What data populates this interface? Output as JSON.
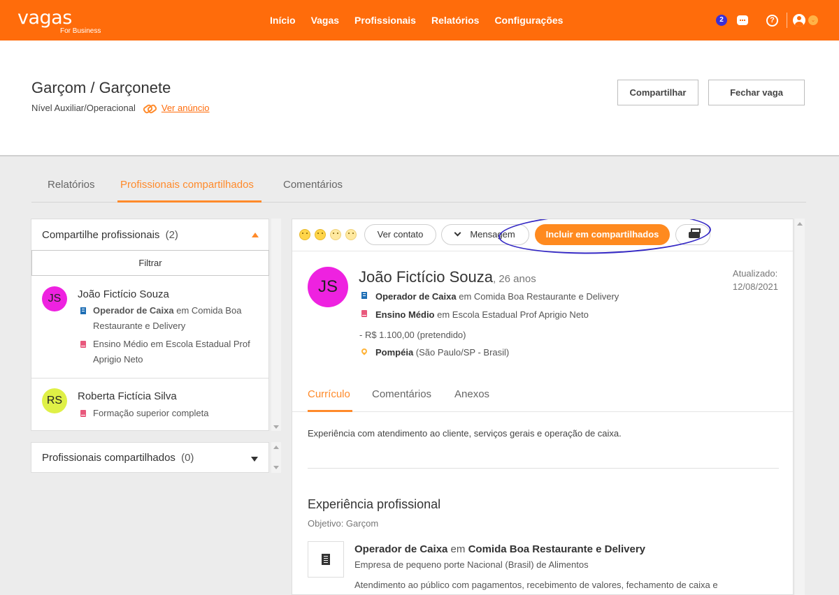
{
  "nav": {
    "logo_main": "vagas",
    "logo_sub": "For Business",
    "links": [
      "Início",
      "Vagas",
      "Profissionais",
      "Relatórios",
      "Configurações"
    ],
    "badge_count": "2",
    "help_glyph": "?",
    "chevron_glyph": "⌄"
  },
  "job": {
    "title": "Garçom / Garçonete",
    "level": "Nível Auxiliar/Operacional",
    "link": "Ver anúncio",
    "share_button": "Compartilhar",
    "close_button": "Fechar vaga"
  },
  "tabs": [
    "Relatórios",
    "Profissionais compartilhados",
    "Comentários"
  ],
  "left_panel": {
    "header": "Compartilhe profissionais",
    "count": "(2)",
    "filter_button": "Filtrar",
    "candidates": [
      {
        "initials": "JS",
        "avatar_color": "#ee22e0",
        "name": "João Fictício Souza",
        "job_bold": "Operador de Caixa",
        "job_rest": " em Comida Boa Restaurante e Delivery",
        "education": "Ensino Médio em Escola Estadual Prof Aprigio Neto"
      },
      {
        "initials": "RS",
        "avatar_color": "#dff046",
        "name": "Roberta Fictícia Silva",
        "education": "Formação superior completa"
      }
    ],
    "shared_header": "Profissionais compartilhados",
    "shared_count": "(0)"
  },
  "toolbar": {
    "contact_button": "Ver contato",
    "message_button": "Mensagem",
    "include_button": "Incluir em compartilhados",
    "accent_color": "#ff8a1f",
    "annotation_color": "#3428c4"
  },
  "candidate": {
    "initials": "JS",
    "name": "João Fictício Souza",
    "age": ", 26 anos",
    "updated_label": "Atualizado:",
    "updated_date": "12/08/2021",
    "job_bold": "Operador de Caixa",
    "job_rest": " em Comida Boa Restaurante e Delivery",
    "edu_bold": "Ensino Médio",
    "edu_rest": " em Escola Estadual Prof Aprigio Neto",
    "salary": "- R$ 1.100,00 (pretendido)",
    "city": "Pompéia",
    "region": " (São Paulo/SP - Brasil)"
  },
  "detail_tabs": [
    "Currículo",
    "Comentários",
    "Anexos"
  ],
  "resume": {
    "summary": "Experiência com atendimento ao cliente, serviços gerais e operação de caixa.",
    "section_title": "Experiência profissional",
    "objective": "Objetivo: Garçom",
    "exp_role": "Operador de Caixa",
    "exp_em": " em ",
    "exp_company": "Comida Boa Restaurante e Delivery",
    "exp_sub": "Empresa de pequeno porte Nacional (Brasil) de Alimentos",
    "exp_desc": "Atendimento ao público com pagamentos, recebimento de valores, fechamento de caixa e"
  },
  "colors": {
    "brand": "#ff6c0b",
    "accent": "#ff8a2a"
  }
}
